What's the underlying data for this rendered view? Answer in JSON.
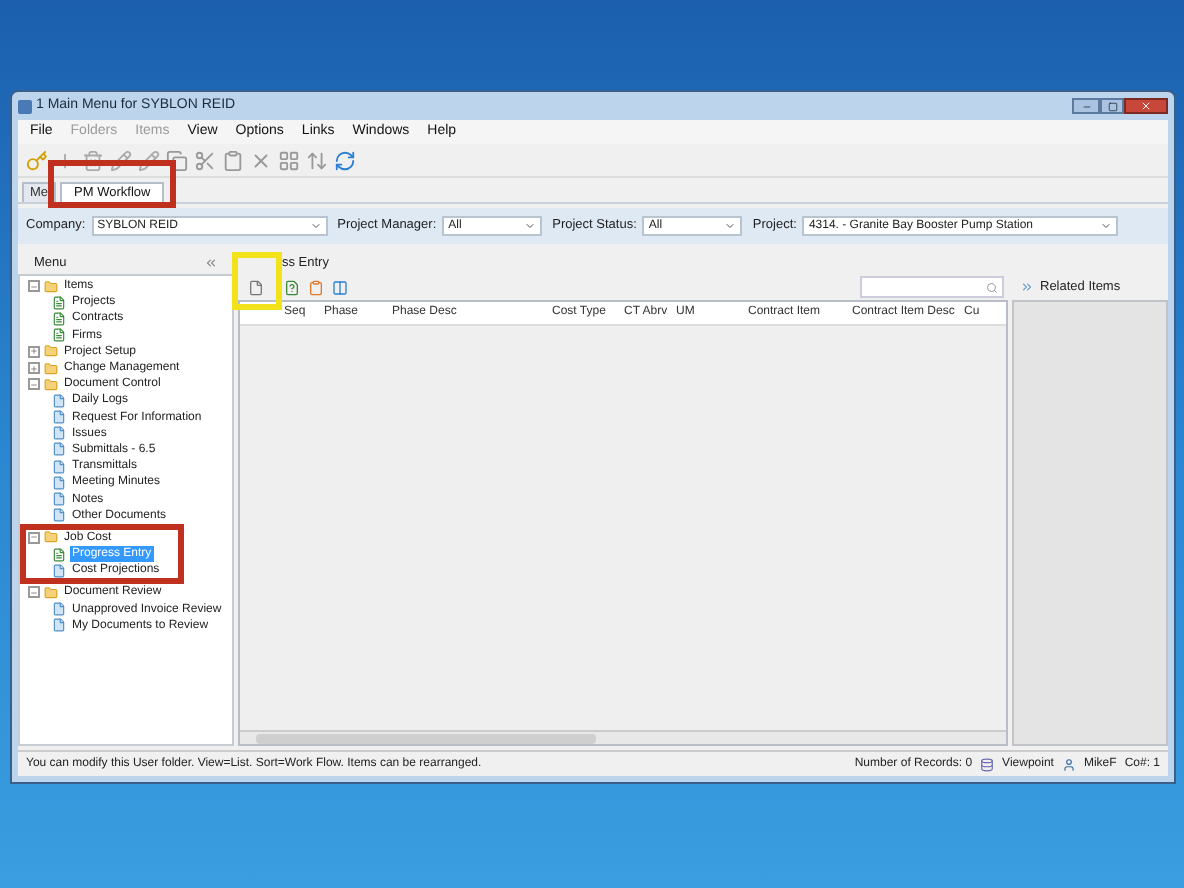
{
  "window": {
    "title": "1 Main Menu for SYBLON REID"
  },
  "menu": [
    {
      "label": "File",
      "disabled": false
    },
    {
      "label": "Folders",
      "disabled": true
    },
    {
      "label": "Items",
      "disabled": true
    },
    {
      "label": "View",
      "disabled": false
    },
    {
      "label": "Options",
      "disabled": false
    },
    {
      "label": "Links",
      "disabled": false
    },
    {
      "label": "Windows",
      "disabled": false
    },
    {
      "label": "Help",
      "disabled": false
    }
  ],
  "tabs": [
    {
      "label": "Me",
      "selected": false,
      "highlight": false
    },
    {
      "label": "PM Workflow",
      "selected": true,
      "highlight": true
    }
  ],
  "filters": [
    {
      "label": "Company:",
      "value": "SYBLON REID"
    },
    {
      "label": "Project Manager:",
      "value": "All"
    },
    {
      "label": "Project Status:",
      "value": "All"
    },
    {
      "label": "Project:",
      "value": "4314. - Granite Bay Booster Pump Station"
    }
  ],
  "menu_panel": {
    "title": "Menu",
    "tree": [
      {
        "label": "Items",
        "kind": "folder",
        "expanded": true,
        "selected": false,
        "highlight": false,
        "children": [
          {
            "label": "Projects",
            "kind": "form",
            "selected": false,
            "highlight": false
          },
          {
            "label": "Contracts",
            "kind": "form",
            "selected": false,
            "highlight": false
          },
          {
            "label": "Firms",
            "kind": "form",
            "selected": false,
            "highlight": false
          }
        ]
      },
      {
        "label": "Project Setup",
        "kind": "folder",
        "expanded": false,
        "selected": false,
        "highlight": false
      },
      {
        "label": "Change Management",
        "kind": "folder",
        "expanded": false,
        "selected": false,
        "highlight": false
      },
      {
        "label": "Document Control",
        "kind": "folder",
        "expanded": true,
        "selected": false,
        "highlight": false,
        "children": [
          {
            "label": "Daily Logs",
            "kind": "doc",
            "selected": false,
            "highlight": false
          },
          {
            "label": "Request For Information",
            "kind": "doc",
            "selected": false,
            "highlight": false
          },
          {
            "label": "Issues",
            "kind": "doc",
            "selected": false,
            "highlight": false
          },
          {
            "label": "Submittals - 6.5",
            "kind": "doc",
            "selected": false,
            "highlight": false
          },
          {
            "label": "Transmittals",
            "kind": "doc",
            "selected": false,
            "highlight": false
          },
          {
            "label": "Meeting Minutes",
            "kind": "doc",
            "selected": false,
            "highlight": false
          },
          {
            "label": "Notes",
            "kind": "doc",
            "selected": false,
            "highlight": false
          },
          {
            "label": "Other Documents",
            "kind": "doc",
            "selected": false,
            "highlight": false
          }
        ]
      },
      {
        "label": "Job Cost",
        "kind": "folder",
        "expanded": true,
        "selected": false,
        "highlight": true,
        "children": [
          {
            "label": "Progress Entry",
            "kind": "form",
            "selected": true,
            "highlight": false
          },
          {
            "label": "Cost Projections",
            "kind": "doc",
            "selected": false,
            "highlight": false
          }
        ]
      },
      {
        "label": "Document Review",
        "kind": "folder",
        "expanded": true,
        "selected": false,
        "highlight": false,
        "children": [
          {
            "label": "Unapproved Invoice Review",
            "kind": "doc",
            "selected": false,
            "highlight": false
          },
          {
            "label": "My Documents to Review",
            "kind": "doc",
            "selected": false,
            "highlight": false
          }
        ]
      }
    ]
  },
  "grid_panel": {
    "title": "ss Entry",
    "new_button_highlight": true,
    "columns": [
      "Seq",
      "Phase",
      "Phase Desc",
      "Cost Type",
      "CT Abrv",
      "UM",
      "Contract Item",
      "Contract Item Desc",
      "Cu"
    ]
  },
  "related_panel": {
    "title": "Related Items"
  },
  "status_bar": {
    "message": "You can modify this User folder. View=List. Sort=Work Flow. Items can be rearranged.",
    "records": "Number of Records: 0",
    "app": "Viewpoint",
    "user": "MikeF",
    "company": "Co#: 1"
  }
}
